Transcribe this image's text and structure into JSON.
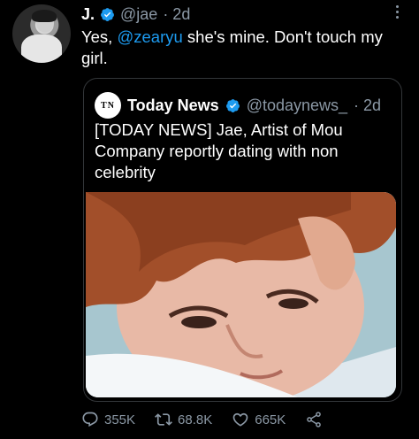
{
  "tweet": {
    "author_name": "J.",
    "author_handle": "@jae",
    "time": "· 2d",
    "text_prefix": "Yes, ",
    "mention": "@zearyu",
    "text_suffix": " she's mine. Don't touch my girl."
  },
  "quoted_tweet": {
    "avatar_text": "TN",
    "author_name": "Today News",
    "author_handle": "@todaynews_",
    "time": "· 2d",
    "text": "[TODAY NEWS] Jae, Artist of Mou Company reportly dating with non celebrity"
  },
  "actions": {
    "reply_count": "355K",
    "retweet_count": "68.8K",
    "like_count": "665K"
  },
  "colors": {
    "background": "#000000",
    "text": "#ffffff",
    "secondary": "#8b98a5",
    "accent": "#1d9bf0"
  },
  "icons": [
    "verified-badge-icon",
    "more-options-icon",
    "reply-icon",
    "retweet-icon",
    "like-icon",
    "share-icon"
  ]
}
